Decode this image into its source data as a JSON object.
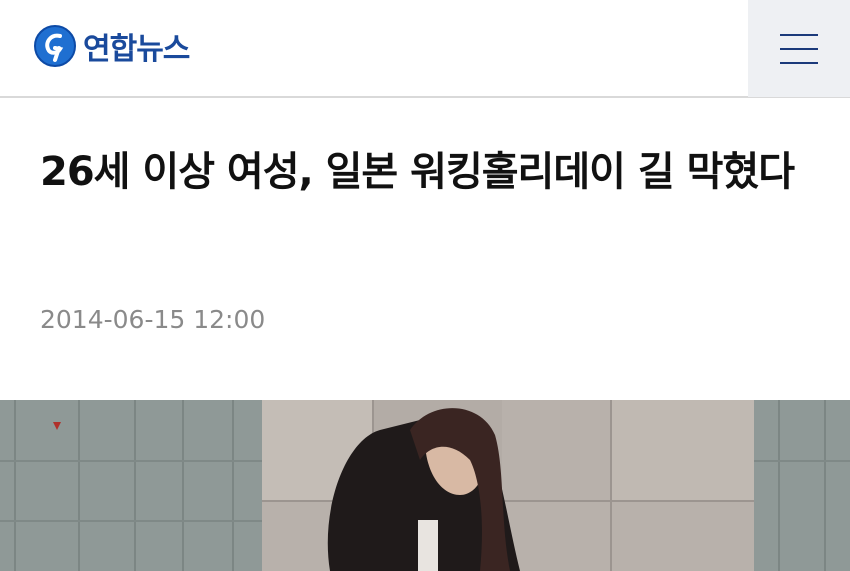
{
  "header": {
    "logo_text": "연합뉴스",
    "logo_icon": "yonhap-logo-icon",
    "menu_icon": "hamburger-menu-icon"
  },
  "article": {
    "title": "26세 이상 여성, 일본 워킹홀리데이 길 막혔다",
    "date": "2014-06-15 12:00"
  },
  "colors": {
    "brand": "#1a4a9c",
    "menu_bg": "#eef0f3",
    "date": "#8a8a8a"
  }
}
